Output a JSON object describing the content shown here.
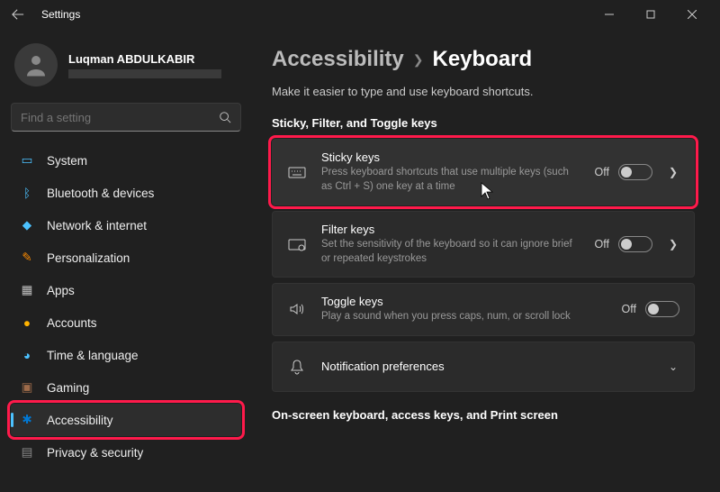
{
  "window": {
    "title": "Settings"
  },
  "user": {
    "name": "Luqman ABDULKABIR"
  },
  "search": {
    "placeholder": "Find a setting"
  },
  "nav": {
    "items": [
      {
        "label": "System",
        "color": "#4cc2ff"
      },
      {
        "label": "Bluetooth & devices",
        "color": "#4cc2ff"
      },
      {
        "label": "Network & internet",
        "color": "#4cc2ff"
      },
      {
        "label": "Personalization",
        "color": "#ff8c00"
      },
      {
        "label": "Apps",
        "color": "#c0c0c0"
      },
      {
        "label": "Accounts",
        "color": "#ffb300"
      },
      {
        "label": "Time & language",
        "color": "#4cc2ff"
      },
      {
        "label": "Gaming",
        "color": "#9e6b4a"
      },
      {
        "label": "Accessibility",
        "color": "#0078d4"
      },
      {
        "label": "Privacy & security",
        "color": "#888"
      }
    ]
  },
  "breadcrumb": {
    "parent": "Accessibility",
    "current": "Keyboard"
  },
  "page": {
    "subtitle": "Make it easier to type and use keyboard shortcuts.",
    "section1_title": "Sticky, Filter, and Toggle keys",
    "section2_title": "On-screen keyboard, access keys, and Print screen"
  },
  "cards": {
    "sticky": {
      "title": "Sticky keys",
      "desc": "Press keyboard shortcuts that use multiple keys (such as Ctrl + S) one key at a time",
      "state": "Off"
    },
    "filter": {
      "title": "Filter keys",
      "desc": "Set the sensitivity of the keyboard so it can ignore brief or repeated keystrokes",
      "state": "Off"
    },
    "toggle": {
      "title": "Toggle keys",
      "desc": "Play a sound when you press caps, num, or scroll lock",
      "state": "Off"
    },
    "notif": {
      "title": "Notification preferences"
    }
  }
}
